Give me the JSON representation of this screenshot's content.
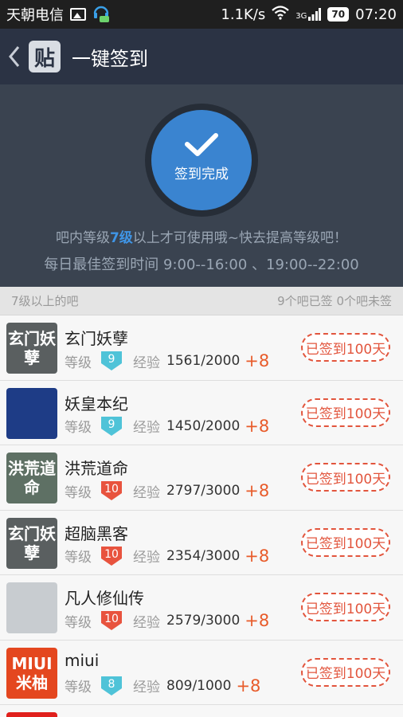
{
  "status_bar": {
    "carrier": "天朝电信",
    "speed": "1.1K/s",
    "network": "3G",
    "battery": "70",
    "time": "07:20"
  },
  "titlebar": {
    "logo_text": "贴",
    "title": "一键签到"
  },
  "header": {
    "check_label": "签到完成",
    "hint_prefix": "吧内等级",
    "hint_level": "7级",
    "hint_suffix": "以上才可使用哦~快去提高等级吧！",
    "best_time": "每日最佳签到时间  9:00--16:00 、19:00--22:00"
  },
  "section": {
    "left_label": "7级以上的吧",
    "right_label": "9个吧已签 0个吧未签"
  },
  "labels": {
    "level": "等级",
    "exp": "经验",
    "plus": "+8"
  },
  "colors": {
    "badge_blue": "#4fc3d8",
    "badge_red": "#e8533e",
    "accent_orange": "#e85b2a"
  },
  "forums": [
    {
      "name": "玄门妖孽",
      "level": "9",
      "exp": "1561/2000",
      "stamp": "已签到100天",
      "avatar_text": "玄门妖孽",
      "avatar_bg": "#5a5f60",
      "badge": "blue"
    },
    {
      "name": "妖皇本纪",
      "level": "9",
      "exp": "1450/2000",
      "stamp": "已签到100天",
      "avatar_text": "",
      "avatar_bg": "#1e3c86",
      "badge": "blue"
    },
    {
      "name": "洪荒道命",
      "level": "10",
      "exp": "2797/3000",
      "stamp": "已签到100天",
      "avatar_text": "洪荒道命",
      "avatar_bg": "#5e7064",
      "badge": "red"
    },
    {
      "name": "超脑黑客",
      "level": "10",
      "exp": "2354/3000",
      "stamp": "已签到100天",
      "avatar_text": "玄门妖孽",
      "avatar_bg": "#5a5f60",
      "badge": "red"
    },
    {
      "name": "凡人修仙传",
      "level": "10",
      "exp": "2579/3000",
      "stamp": "已签到100天",
      "avatar_text": "",
      "avatar_bg": "#c8ccd0",
      "badge": "red"
    },
    {
      "name": "miui",
      "level": "8",
      "exp": "809/1000",
      "stamp": "已签到100天",
      "avatar_text": "MIUI 米柚",
      "avatar_bg": "#e4471f",
      "badge": "blue"
    }
  ]
}
